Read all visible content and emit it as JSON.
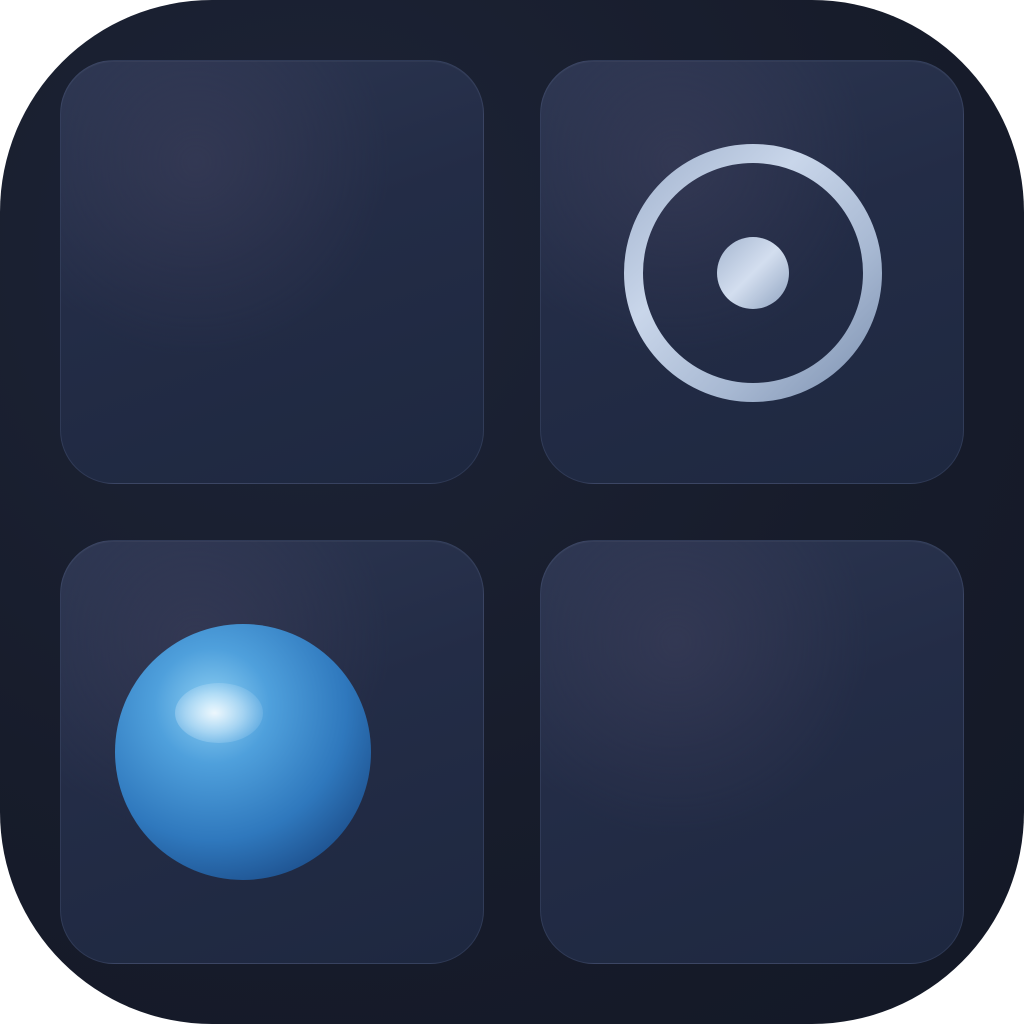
{
  "app_icon": {
    "grid": [
      {
        "slot": "top-left",
        "content": "empty"
      },
      {
        "slot": "top-right",
        "content": "target-icon"
      },
      {
        "slot": "bottom-left",
        "content": "blue-sphere-icon"
      },
      {
        "slot": "bottom-right",
        "content": "empty"
      }
    ],
    "colors": {
      "background": "#151a28",
      "tile": "#232c46",
      "ring": "#b4c4dc",
      "sphere": "#3a87cc"
    }
  }
}
